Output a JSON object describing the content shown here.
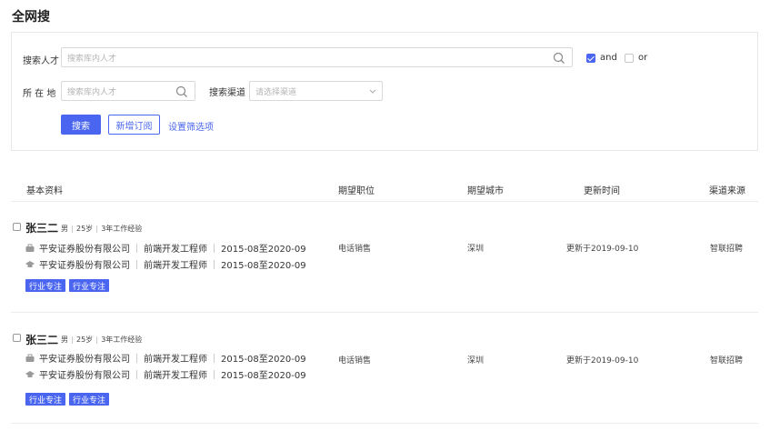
{
  "page": {
    "title": "全网搜"
  },
  "search": {
    "talent_label": "搜索人才",
    "talent_placeholder": "搜索库内人才",
    "and_label": "and",
    "or_label": "or",
    "location_label": "所 在 地",
    "location_placeholder": "搜索库内人才",
    "channel_label": "搜索渠道",
    "channel_placeholder": "请选择渠道",
    "search_button": "搜索",
    "subscribe_button": "新增订阅",
    "filter_link": "设置筛选项"
  },
  "table": {
    "headers": [
      "基本资料",
      "期望职位",
      "期望城市",
      "更新时间",
      "渠道来源"
    ],
    "rows": [
      {
        "name": "张三二",
        "gender": "男",
        "age": "25岁",
        "experience": "3年工作经验",
        "work": {
          "company": "平安证券股份有限公司",
          "position": "前端开发工程师",
          "period": "2015-08至2020-09"
        },
        "edu": {
          "company": "平安证券股份有限公司",
          "position": "前端开发工程师",
          "period": "2015-08至2020-09"
        },
        "tags": [
          "行业专注",
          "行业专注"
        ],
        "expected_position": "电话销售",
        "expected_city": "深圳",
        "updated": "更新于2019-09-10",
        "source": "智联招聘"
      },
      {
        "name": "张三二",
        "gender": "男",
        "age": "25岁",
        "experience": "3年工作经验",
        "work": {
          "company": "平安证券股份有限公司",
          "position": "前端开发工程师",
          "period": "2015-08至2020-09"
        },
        "edu": {
          "company": "平安证券股份有限公司",
          "position": "前端开发工程师",
          "period": "2015-08至2020-09"
        },
        "tags": [
          "行业专注",
          "行业专注"
        ],
        "expected_position": "电话销售",
        "expected_city": "深圳",
        "updated": "更新于2019-09-10",
        "source": "智联招聘"
      }
    ]
  },
  "colors": {
    "accent": "#4a66f0",
    "border": "#e6e6e6"
  },
  "icons": {
    "search": "magnifier-icon",
    "work": "briefcase-icon",
    "edu": "graduation-cap-icon",
    "dropdown": "chevron-down-icon"
  }
}
